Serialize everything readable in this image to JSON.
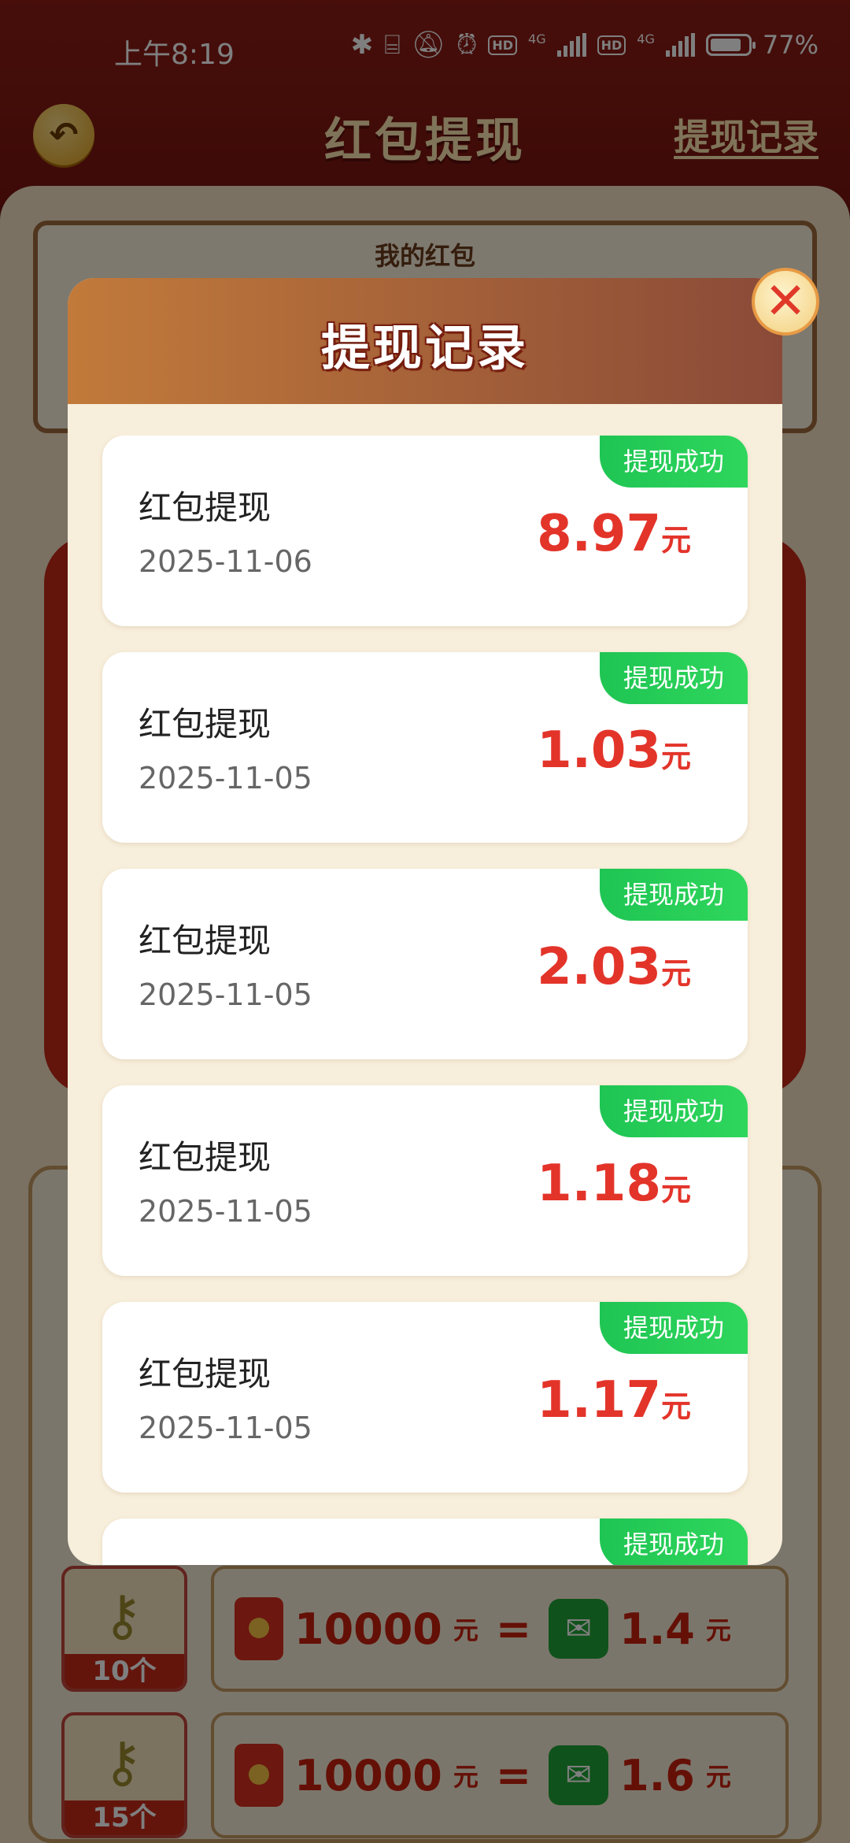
{
  "status_bar": {
    "time": "上午8:19",
    "battery": "77%",
    "net1": "4G",
    "net2": "4G",
    "hd": "HD"
  },
  "page": {
    "title": "红包提现",
    "record_link": "提现记录",
    "section_title": "我的红包"
  },
  "rates": [
    {
      "count": "10个",
      "red": "10000",
      "red_unit": "元",
      "eq": "=",
      "wx": "1.4",
      "wx_unit": "元"
    },
    {
      "count": "15个",
      "red": "10000",
      "red_unit": "元",
      "eq": "=",
      "wx": "1.6",
      "wx_unit": "元"
    }
  ],
  "modal": {
    "title": "提现记录",
    "close_icon": "close-icon",
    "records": [
      {
        "title": "红包提现",
        "date": "2025-11-06",
        "amount": "8.97",
        "unit": "元",
        "status": "提现成功"
      },
      {
        "title": "红包提现",
        "date": "2025-11-05",
        "amount": "1.03",
        "unit": "元",
        "status": "提现成功"
      },
      {
        "title": "红包提现",
        "date": "2025-11-05",
        "amount": "2.03",
        "unit": "元",
        "status": "提现成功"
      },
      {
        "title": "红包提现",
        "date": "2025-11-05",
        "amount": "1.18",
        "unit": "元",
        "status": "提现成功"
      },
      {
        "title": "红包提现",
        "date": "2025-11-05",
        "amount": "1.17",
        "unit": "元",
        "status": "提现成功"
      },
      {
        "status": "提现成功"
      }
    ]
  },
  "colors": {
    "accent_red": "#e3342a",
    "success_green": "#2fd65c",
    "header_brown": "#a45a38"
  }
}
